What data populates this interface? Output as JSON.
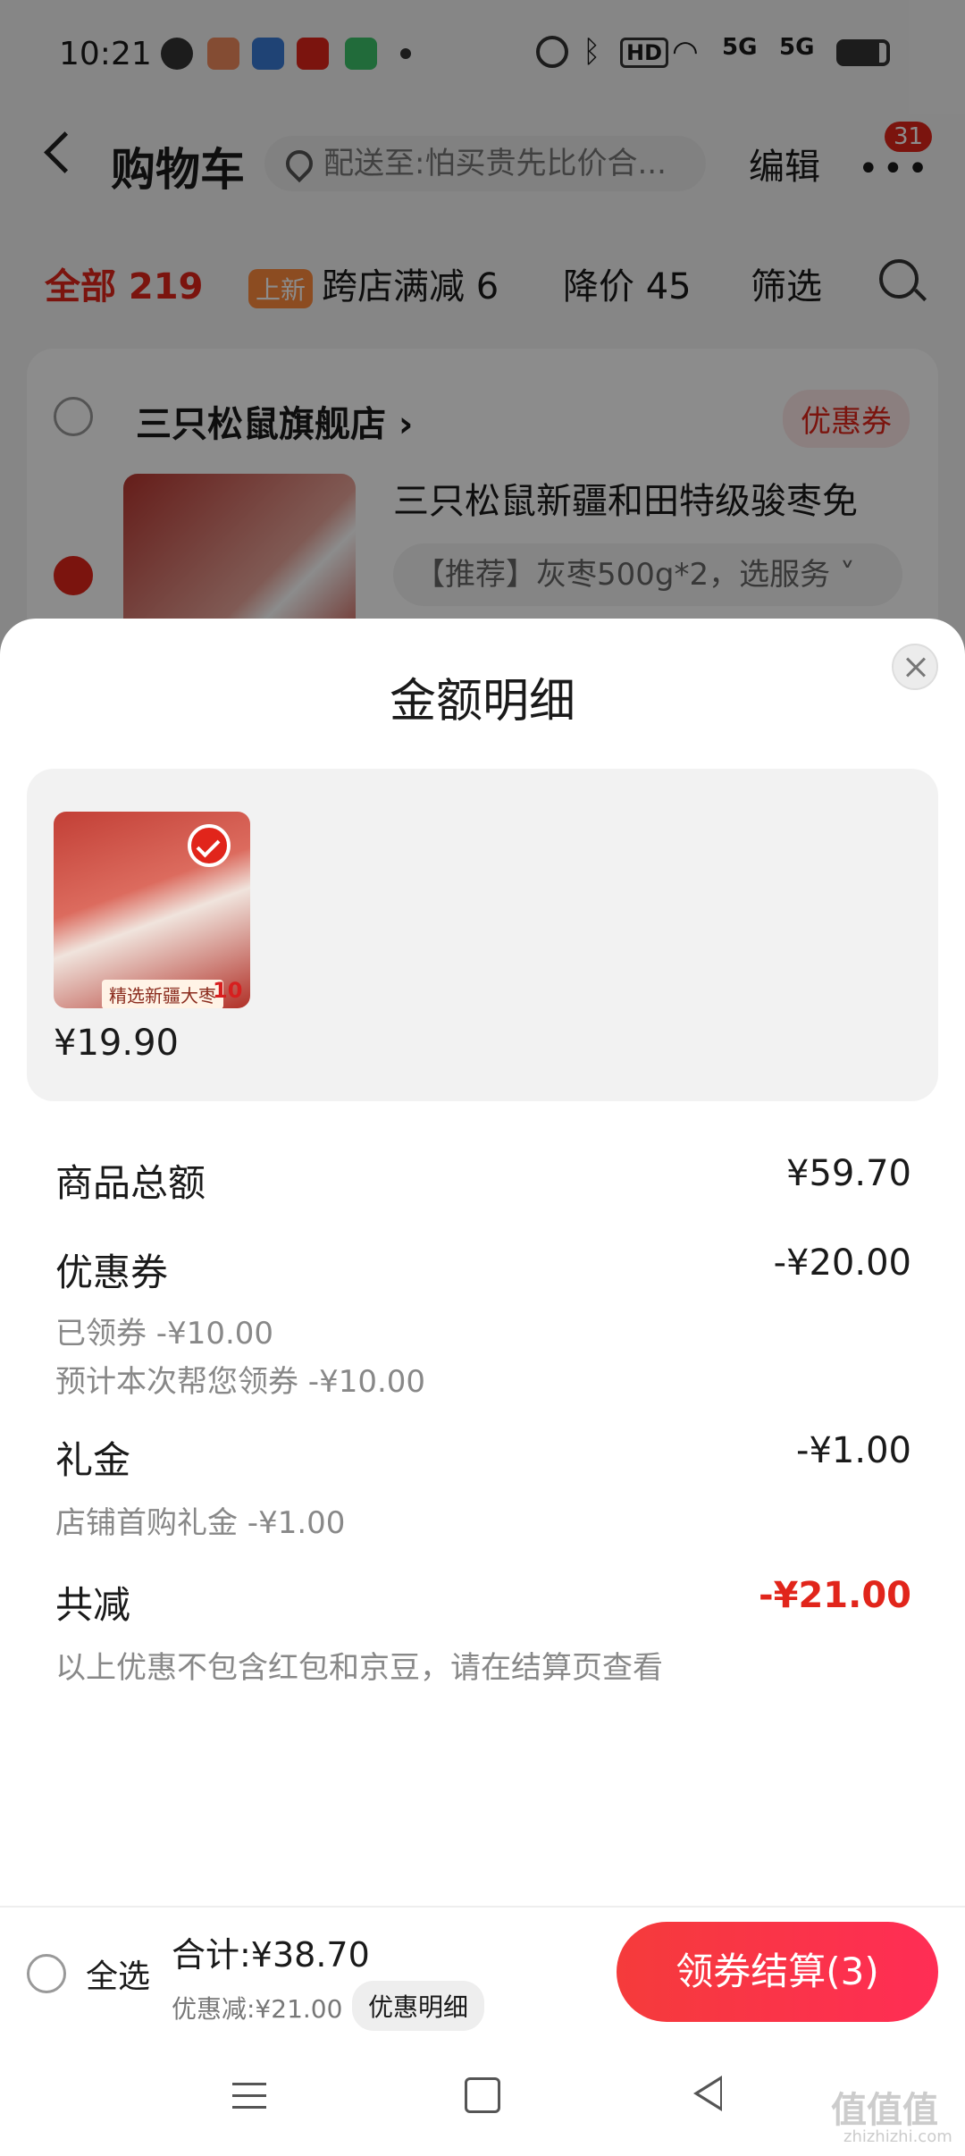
{
  "status_bar": {
    "time": "10:21",
    "signal": "5G",
    "hd": "HD"
  },
  "header": {
    "title": "购物车",
    "address": "配送至:怕买贵先比价合...",
    "edit": "编辑",
    "more": "•••",
    "badge": "31"
  },
  "tabs": {
    "all": "全部 219",
    "new_tag": "上新",
    "cross_store": "跨店满减 6",
    "price_drop": "降价 45",
    "filter": "筛选"
  },
  "store": {
    "name": "三只松鼠旗舰店 ›",
    "coupon": "优惠券",
    "product_name": "三只松鼠新疆和田特级骏枣免",
    "spec": "【推荐】灰枣500g*2，选服务 ˅"
  },
  "sheet": {
    "title": "金额明细",
    "item_price": "¥19.90",
    "item_caption": "精选新疆大枣",
    "item_number": "10",
    "rows": {
      "goods_total_label": "商品总额",
      "goods_total_value": "¥59.70",
      "coupon_label": "优惠券",
      "coupon_value": "-¥20.00",
      "coupon_sub1": "已领券 -¥10.00",
      "coupon_sub2": "预计本次帮您领券 -¥10.00",
      "gift_label": "礼金",
      "gift_value": "-¥1.00",
      "gift_sub": "店铺首购礼金 -¥1.00",
      "total_cut_label": "共减",
      "total_cut_value": "-¥21.00",
      "note": "以上优惠不包含红包和京豆，请在结算页查看"
    }
  },
  "bottom": {
    "select_all": "全选",
    "total": "合计:¥38.70",
    "saved": "优惠减:¥21.00",
    "detail": "优惠明细",
    "checkout": "领券结算(3)"
  },
  "watermark": {
    "text": "值值值",
    "url": "zhizhizhi.com"
  },
  "colors": {
    "accent": "#e1251b",
    "checkout_gradient_start": "#f53b3b",
    "checkout_gradient_end": "#ff2d55"
  }
}
